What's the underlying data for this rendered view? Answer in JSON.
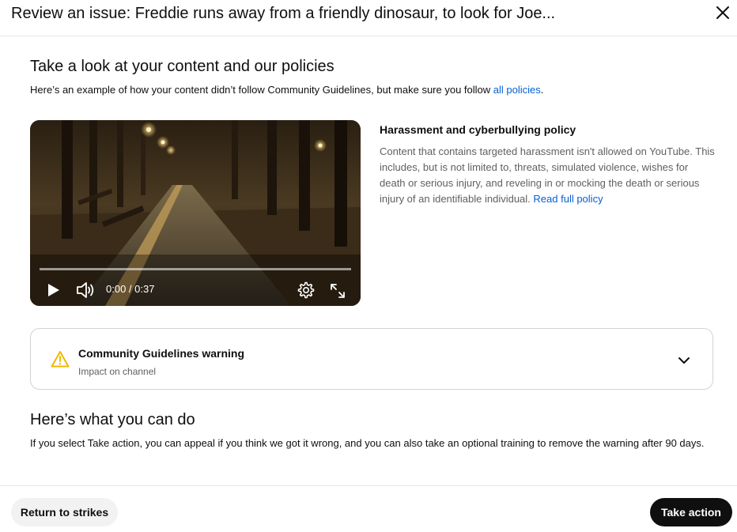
{
  "header": {
    "title": "Review an issue: Freddie runs away from a friendly dinosaur, to look for Joe...",
    "close_icon": "close-icon"
  },
  "content_section": {
    "title": "Take a look at your content and our policies",
    "description": "Here’s an example of how your content didn’t follow Community Guidelines, but make sure you follow ",
    "policies_link": "all policies",
    "description_end": "."
  },
  "video_player": {
    "time_display": "0:00 / 0:37",
    "progress": 0,
    "icons": [
      "play-icon",
      "volume-icon",
      "settings-gear-icon",
      "fullscreen-icon"
    ]
  },
  "policy": {
    "title": "Harassment and cyberbullying policy",
    "text": "Content that contains targeted harassment isn't allowed on YouTube. This includes, but is not limited to, threats, simulated violence, wishes for death or serious injury, and reveling in or mocking the death or serious injury of an identifiable individual. ",
    "read_more": "Read full policy"
  },
  "warning": {
    "title": "Community Guidelines warning",
    "subtitle": "Impact on channel",
    "icon": "warning-triangle-icon",
    "expanded": false
  },
  "actions_section": {
    "title": "Here’s what you can do",
    "description": "If you select Take action, you can appeal if you think we got it wrong, and you can also take an optional training to remove the warning after 90 days."
  },
  "footer": {
    "return_label": "Return to strikes",
    "take_action_label": "Take action"
  },
  "colors": {
    "link": "#065fd4",
    "primary_button": "#0f0f0f",
    "secondary_button": "#f2f2f2",
    "warning_icon": "#f2b705"
  }
}
